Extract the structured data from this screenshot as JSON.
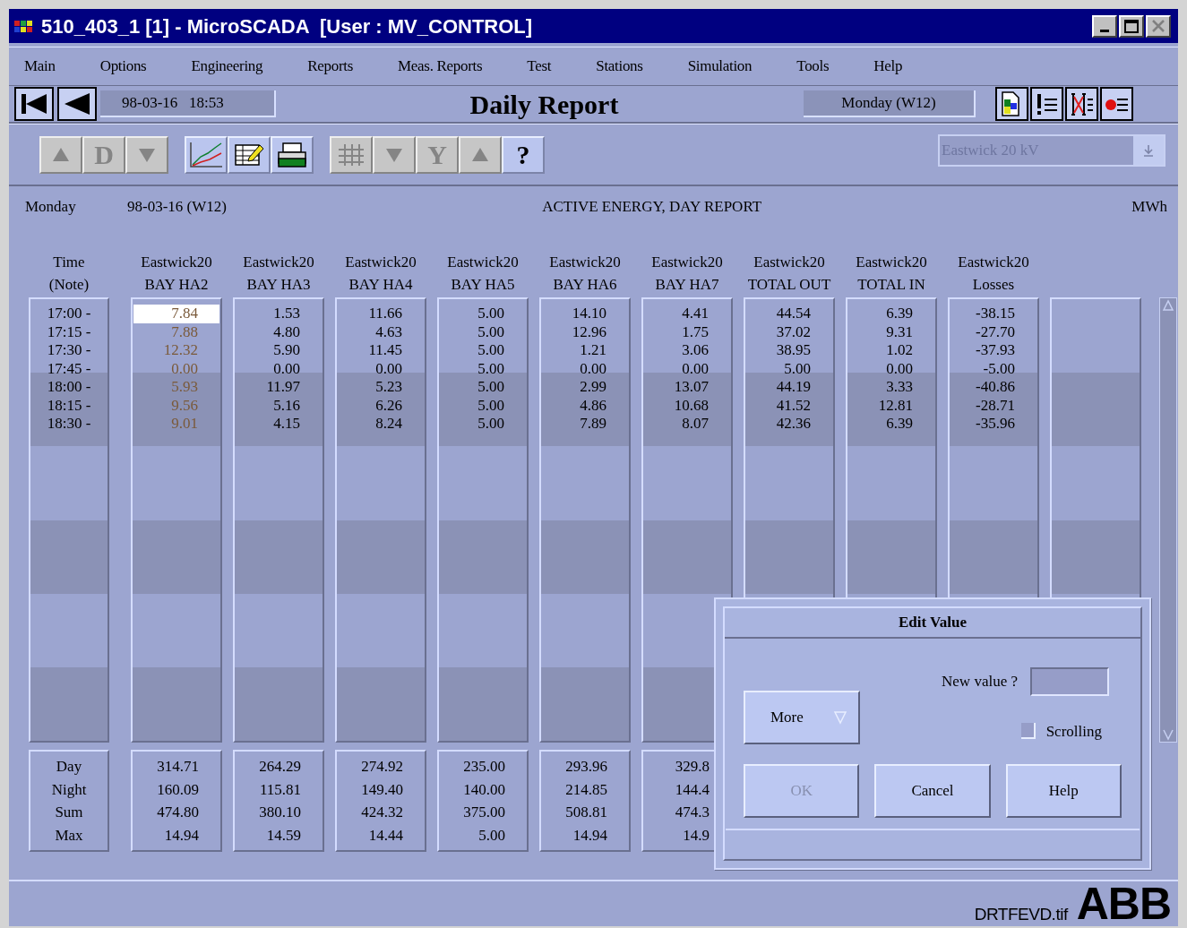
{
  "window": {
    "title": "510_403_1 [1] - MicroSCADA  [User : MV_CONTROL]"
  },
  "menu": [
    "Main",
    "Options",
    "Engineering",
    "Reports",
    "Meas. Reports",
    "Test",
    "Stations",
    "Simulation",
    "Tools",
    "Help"
  ],
  "nav_buttons": [
    {
      "kind": "first"
    },
    {
      "kind": "back"
    }
  ],
  "timestamp": "98-03-16   18:53",
  "report_title": "Daily Report",
  "day_field": "Monday (W12)",
  "view_buttons": [
    {
      "kind": "document"
    },
    {
      "kind": "exclaim"
    },
    {
      "kind": "crossed"
    },
    {
      "kind": "dot"
    }
  ],
  "toolbar": [
    {
      "buttons": [
        {
          "kind": "up",
          "disabled": true
        },
        {
          "kind": "text",
          "label": "D",
          "disabled": true
        },
        {
          "kind": "down",
          "disabled": true
        }
      ]
    },
    {
      "buttons": [
        {
          "kind": "chart",
          "disabled": false
        },
        {
          "kind": "edit",
          "disabled": false
        },
        {
          "kind": "print",
          "disabled": false
        }
      ]
    },
    {
      "buttons": [
        {
          "kind": "grid",
          "disabled": true
        },
        {
          "kind": "down",
          "disabled": true
        },
        {
          "kind": "text",
          "label": "Y",
          "disabled": true
        },
        {
          "kind": "up",
          "disabled": true
        },
        {
          "kind": "text",
          "label": "?",
          "disabled": false
        }
      ]
    }
  ],
  "station_select": {
    "value": "Eastwick 20 kV",
    "disabled": true
  },
  "report_header": {
    "day": "Monday",
    "date": "98-03-16 (W12)",
    "title": "ACTIVE ENERGY, DAY REPORT",
    "unit": "MWh"
  },
  "time_column": {
    "header": [
      "Time",
      "(Note)"
    ],
    "rows": [
      "17:00 -",
      "17:15 -",
      "17:30 -",
      "17:45 -",
      "18:00 -",
      "18:15 -",
      "18:30 -"
    ],
    "summary": [
      "Day",
      "Night",
      "Sum",
      "Max"
    ]
  },
  "columns": [
    {
      "kind": "data",
      "header": [
        "Eastwick20",
        "BAY HA2"
      ],
      "color": "#7a5a3a",
      "values": [
        {
          "text": "7.84",
          "selected": true
        },
        {
          "text": "7.88",
          "selected": false
        },
        {
          "text": "12.32",
          "selected": false
        },
        {
          "text": "0.00",
          "selected": false
        },
        {
          "text": "5.93",
          "selected": false
        },
        {
          "text": "9.56",
          "selected": false
        },
        {
          "text": "9.01",
          "selected": false
        }
      ],
      "summary": [
        "314.71",
        "160.09",
        "474.80",
        "14.94"
      ]
    },
    {
      "kind": "data",
      "header": [
        "Eastwick20",
        "BAY HA3"
      ],
      "color": "#000000",
      "values": [
        {
          "text": "1.53",
          "selected": false
        },
        {
          "text": "4.80",
          "selected": false
        },
        {
          "text": "5.90",
          "selected": false
        },
        {
          "text": "0.00",
          "selected": false
        },
        {
          "text": "11.97",
          "selected": false
        },
        {
          "text": "5.16",
          "selected": false
        },
        {
          "text": "4.15",
          "selected": false
        }
      ],
      "summary": [
        "264.29",
        "115.81",
        "380.10",
        "14.59"
      ]
    },
    {
      "kind": "data",
      "header": [
        "Eastwick20",
        "BAY HA4"
      ],
      "color": "#000000",
      "values": [
        {
          "text": "11.66",
          "selected": false
        },
        {
          "text": "4.63",
          "selected": false
        },
        {
          "text": "11.45",
          "selected": false
        },
        {
          "text": "0.00",
          "selected": false
        },
        {
          "text": "5.23",
          "selected": false
        },
        {
          "text": "6.26",
          "selected": false
        },
        {
          "text": "8.24",
          "selected": false
        }
      ],
      "summary": [
        "274.92",
        "149.40",
        "424.32",
        "14.44"
      ]
    },
    {
      "kind": "data",
      "header": [
        "Eastwick20",
        "BAY HA5"
      ],
      "color": "#000000",
      "values": [
        {
          "text": "5.00",
          "selected": false
        },
        {
          "text": "5.00",
          "selected": false
        },
        {
          "text": "5.00",
          "selected": false
        },
        {
          "text": "5.00",
          "selected": false
        },
        {
          "text": "5.00",
          "selected": false
        },
        {
          "text": "5.00",
          "selected": false
        },
        {
          "text": "5.00",
          "selected": false
        }
      ],
      "summary": [
        "235.00",
        "140.00",
        "375.00",
        "5.00"
      ]
    },
    {
      "kind": "data",
      "header": [
        "Eastwick20",
        "BAY HA6"
      ],
      "color": "#000000",
      "values": [
        {
          "text": "14.10",
          "selected": false
        },
        {
          "text": "12.96",
          "selected": false
        },
        {
          "text": "1.21",
          "selected": false
        },
        {
          "text": "0.00",
          "selected": false
        },
        {
          "text": "2.99",
          "selected": false
        },
        {
          "text": "4.86",
          "selected": false
        },
        {
          "text": "7.89",
          "selected": false
        }
      ],
      "summary": [
        "293.96",
        "214.85",
        "508.81",
        "14.94"
      ]
    },
    {
      "kind": "data",
      "header": [
        "Eastwick20",
        "BAY HA7"
      ],
      "color": "#000000",
      "values": [
        {
          "text": "4.41",
          "selected": false
        },
        {
          "text": "1.75",
          "selected": false
        },
        {
          "text": "3.06",
          "selected": false
        },
        {
          "text": "0.00",
          "selected": false
        },
        {
          "text": "13.07",
          "selected": false
        },
        {
          "text": "10.68",
          "selected": false
        },
        {
          "text": "8.07",
          "selected": false
        }
      ],
      "summary": [
        "329.8",
        "144.4",
        "474.3",
        "14.9"
      ]
    },
    {
      "kind": "data",
      "header": [
        "Eastwick20",
        "TOTAL OUT"
      ],
      "color": "#000000",
      "values": [
        {
          "text": "44.54",
          "selected": false
        },
        {
          "text": "37.02",
          "selected": false
        },
        {
          "text": "38.95",
          "selected": false
        },
        {
          "text": "5.00",
          "selected": false
        },
        {
          "text": "44.19",
          "selected": false
        },
        {
          "text": "41.52",
          "selected": false
        },
        {
          "text": "42.36",
          "selected": false
        }
      ]
    },
    {
      "kind": "data",
      "header": [
        "Eastwick20",
        "TOTAL IN"
      ],
      "color": "#000000",
      "values": [
        {
          "text": "6.39",
          "selected": false
        },
        {
          "text": "9.31",
          "selected": false
        },
        {
          "text": "1.02",
          "selected": false
        },
        {
          "text": "0.00",
          "selected": false
        },
        {
          "text": "3.33",
          "selected": false
        },
        {
          "text": "12.81",
          "selected": false
        },
        {
          "text": "6.39",
          "selected": false
        }
      ]
    },
    {
      "kind": "data",
      "header": [
        "Eastwick20",
        "Losses"
      ],
      "color": "#000000",
      "values": [
        {
          "text": "-38.15",
          "selected": false
        },
        {
          "text": "-27.70",
          "selected": false
        },
        {
          "text": "-37.93",
          "selected": false
        },
        {
          "text": "-5.00",
          "selected": false
        },
        {
          "text": "-40.86",
          "selected": false
        },
        {
          "text": "-28.71",
          "selected": false
        },
        {
          "text": "-35.96",
          "selected": false
        }
      ]
    },
    {
      "kind": "empty"
    }
  ],
  "dialog": {
    "title": "Edit Value",
    "prompt": "New value ?",
    "more_button": "More",
    "scrolling": {
      "label": "Scrolling",
      "checked": false
    },
    "buttons": [
      {
        "label": "OK",
        "disabled": true
      },
      {
        "label": "Cancel",
        "disabled": false
      },
      {
        "label": "Help",
        "disabled": false
      }
    ]
  },
  "status_bar": {
    "file": "DRTFEVD.tif",
    "logo": "ABB"
  }
}
